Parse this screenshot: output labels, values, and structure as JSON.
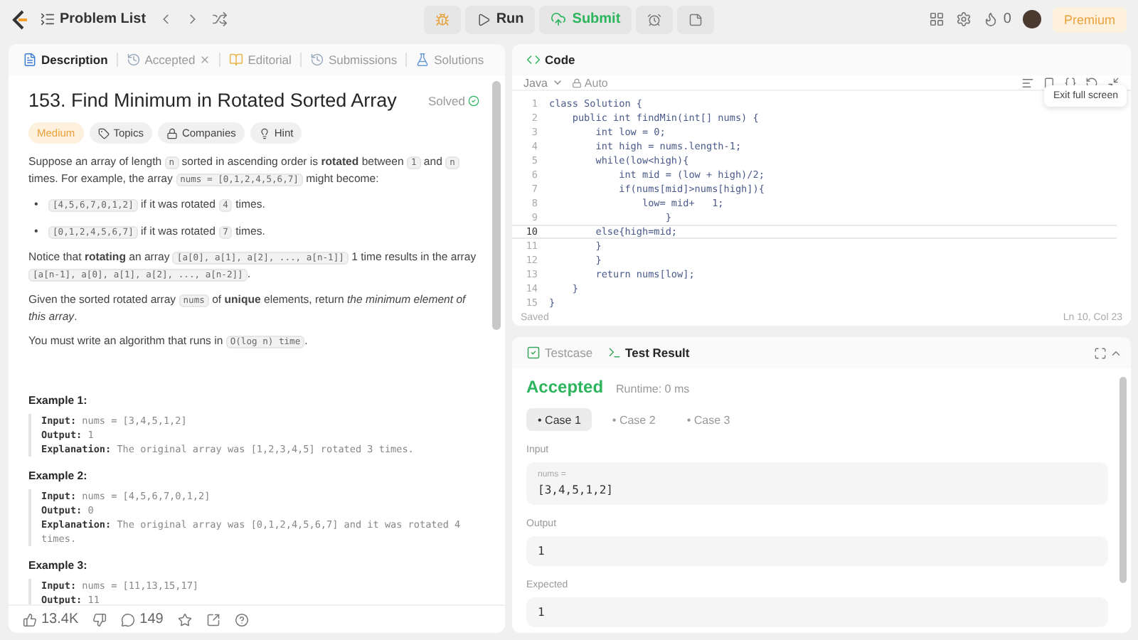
{
  "topbar": {
    "problem_list": "Problem List",
    "run": "Run",
    "submit": "Submit",
    "streak": "0",
    "premium": "Premium"
  },
  "description_tabs": [
    {
      "label": "Description",
      "selected": true,
      "closable": false
    },
    {
      "label": "Accepted",
      "selected": false,
      "closable": true
    },
    {
      "label": "Editorial",
      "selected": false,
      "closable": false
    },
    {
      "label": "Submissions",
      "selected": false,
      "closable": false
    },
    {
      "label": "Solutions",
      "selected": false,
      "closable": false
    }
  ],
  "problem": {
    "title": "153. Find Minimum in Rotated Sorted Array",
    "status": "Solved",
    "difficulty": "Medium",
    "tags": [
      {
        "label": "Topics"
      },
      {
        "label": "Companies"
      },
      {
        "label": "Hint"
      }
    ],
    "blocks": [
      {
        "kind": "para",
        "segments": [
          {
            "kind": "text",
            "text": "Suppose an array of length "
          },
          {
            "kind": "code",
            "text": "n"
          },
          {
            "kind": "text",
            "text": " sorted in ascending order is **rotated** between "
          },
          {
            "kind": "code",
            "text": "1"
          },
          {
            "kind": "text",
            "text": " and "
          },
          {
            "kind": "code",
            "text": "n"
          },
          {
            "kind": "text",
            "text": " times. For example, the array "
          },
          {
            "kind": "code",
            "text": "nums = [0,1,2,4,5,6,7]"
          },
          {
            "kind": "text",
            "text": " might become:"
          }
        ]
      },
      {
        "kind": "bullet",
        "marker": "•",
        "segments": [
          {
            "kind": "code",
            "text": "[4,5,6,7,0,1,2]"
          },
          {
            "kind": "text",
            "text": " if it was rotated "
          },
          {
            "kind": "code",
            "text": "4"
          },
          {
            "kind": "text",
            "text": " times."
          }
        ]
      },
      {
        "kind": "bullet",
        "marker": "•",
        "segments": [
          {
            "kind": "code",
            "text": "[0,1,2,4,5,6,7]"
          },
          {
            "kind": "text",
            "text": " if it was rotated "
          },
          {
            "kind": "code",
            "text": "7"
          },
          {
            "kind": "text",
            "text": " times."
          }
        ]
      },
      {
        "kind": "para",
        "segments": [
          {
            "kind": "text",
            "text": "Notice that **rotating** an array "
          },
          {
            "kind": "code",
            "text": "[a[0], a[1], a[2], ..., a[n-1]]"
          },
          {
            "kind": "text",
            "text": " 1 time results in the array "
          },
          {
            "kind": "code",
            "text": "[a[n-1], a[0], a[1], a[2], ..., a[n-2]]"
          },
          {
            "kind": "text",
            "text": "."
          }
        ]
      },
      {
        "kind": "para",
        "segments": [
          {
            "kind": "text",
            "text": "Given the sorted rotated array "
          },
          {
            "kind": "code",
            "text": "nums"
          },
          {
            "kind": "text",
            "text": " of **unique** elements, return *the minimum element of this array*."
          }
        ]
      },
      {
        "kind": "para",
        "segments": [
          {
            "kind": "text",
            "text": "You must write an algorithm that runs in "
          },
          {
            "kind": "code",
            "text": "O(log n) time"
          },
          {
            "kind": "text",
            "text": "."
          }
        ]
      }
    ],
    "examples": [
      {
        "heading": "Example 1:",
        "lines": [
          {
            "label": "Input:",
            "value": "nums = [3,4,5,1,2]"
          },
          {
            "label": "Output:",
            "value": "1"
          },
          {
            "label": "Explanation:",
            "value": "The original array was [1,2,3,4,5] rotated 3 times."
          }
        ]
      },
      {
        "heading": "Example 2:",
        "lines": [
          {
            "label": "Input:",
            "value": "nums = [4,5,6,7,0,1,2]"
          },
          {
            "label": "Output:",
            "value": "0"
          },
          {
            "label": "Explanation:",
            "value": "The original array was [0,1,2,4,5,6,7] and it was rotated 4 times."
          }
        ]
      },
      {
        "heading": "Example 3:",
        "lines": [
          {
            "label": "Input:",
            "value": "nums = [11,13,15,17]"
          },
          {
            "label": "Output:",
            "value": "11"
          }
        ]
      }
    ]
  },
  "footer": {
    "likes": "13.4K",
    "comments": "149"
  },
  "editor": {
    "tab": "Code",
    "language": "Java",
    "mode": "Auto",
    "tooltip": "Exit full screen",
    "status": "Saved",
    "cursor": "Ln 10, Col 23",
    "lines": [
      {
        "number": "1",
        "text": "class Solution {",
        "active": false
      },
      {
        "number": "2",
        "text": "    public int findMin(int[] nums) {",
        "active": false
      },
      {
        "number": "3",
        "text": "        int low = 0;",
        "active": false
      },
      {
        "number": "4",
        "text": "        int high = nums.length-1;",
        "active": false
      },
      {
        "number": "5",
        "text": "        while(low<high){",
        "active": false
      },
      {
        "number": "6",
        "text": "            int mid = (low + high)/2;",
        "active": false
      },
      {
        "number": "7",
        "text": "            if(nums[mid]>nums[high]){",
        "active": false
      },
      {
        "number": "8",
        "text": "                low= mid+   1;",
        "active": false
      },
      {
        "number": "9",
        "text": "                    }",
        "active": false
      },
      {
        "number": "10",
        "text": "        else{high=mid;",
        "active": true
      },
      {
        "number": "11",
        "text": "        }",
        "active": false
      },
      {
        "number": "12",
        "text": "        }",
        "active": false
      },
      {
        "number": "13",
        "text": "        return nums[low];",
        "active": false
      },
      {
        "number": "14",
        "text": "    }",
        "active": false
      },
      {
        "number": "15",
        "text": "}",
        "active": false
      }
    ]
  },
  "results": {
    "tabs": [
      {
        "label": "Testcase",
        "selected": false
      },
      {
        "label": "Test Result",
        "selected": true
      }
    ],
    "verdict": "Accepted",
    "runtime": "Runtime: 0 ms",
    "cases": [
      {
        "marker": "•",
        "label": "Case 1",
        "selected": true
      },
      {
        "marker": "•",
        "label": "Case 2",
        "selected": false
      },
      {
        "marker": "•",
        "label": "Case 3",
        "selected": false
      }
    ],
    "input_label": "Input",
    "param_name": "nums =",
    "input_value": "[3,4,5,1,2]",
    "output_label": "Output",
    "output_value": "1",
    "expected_label": "Expected",
    "expected_value": "1"
  }
}
